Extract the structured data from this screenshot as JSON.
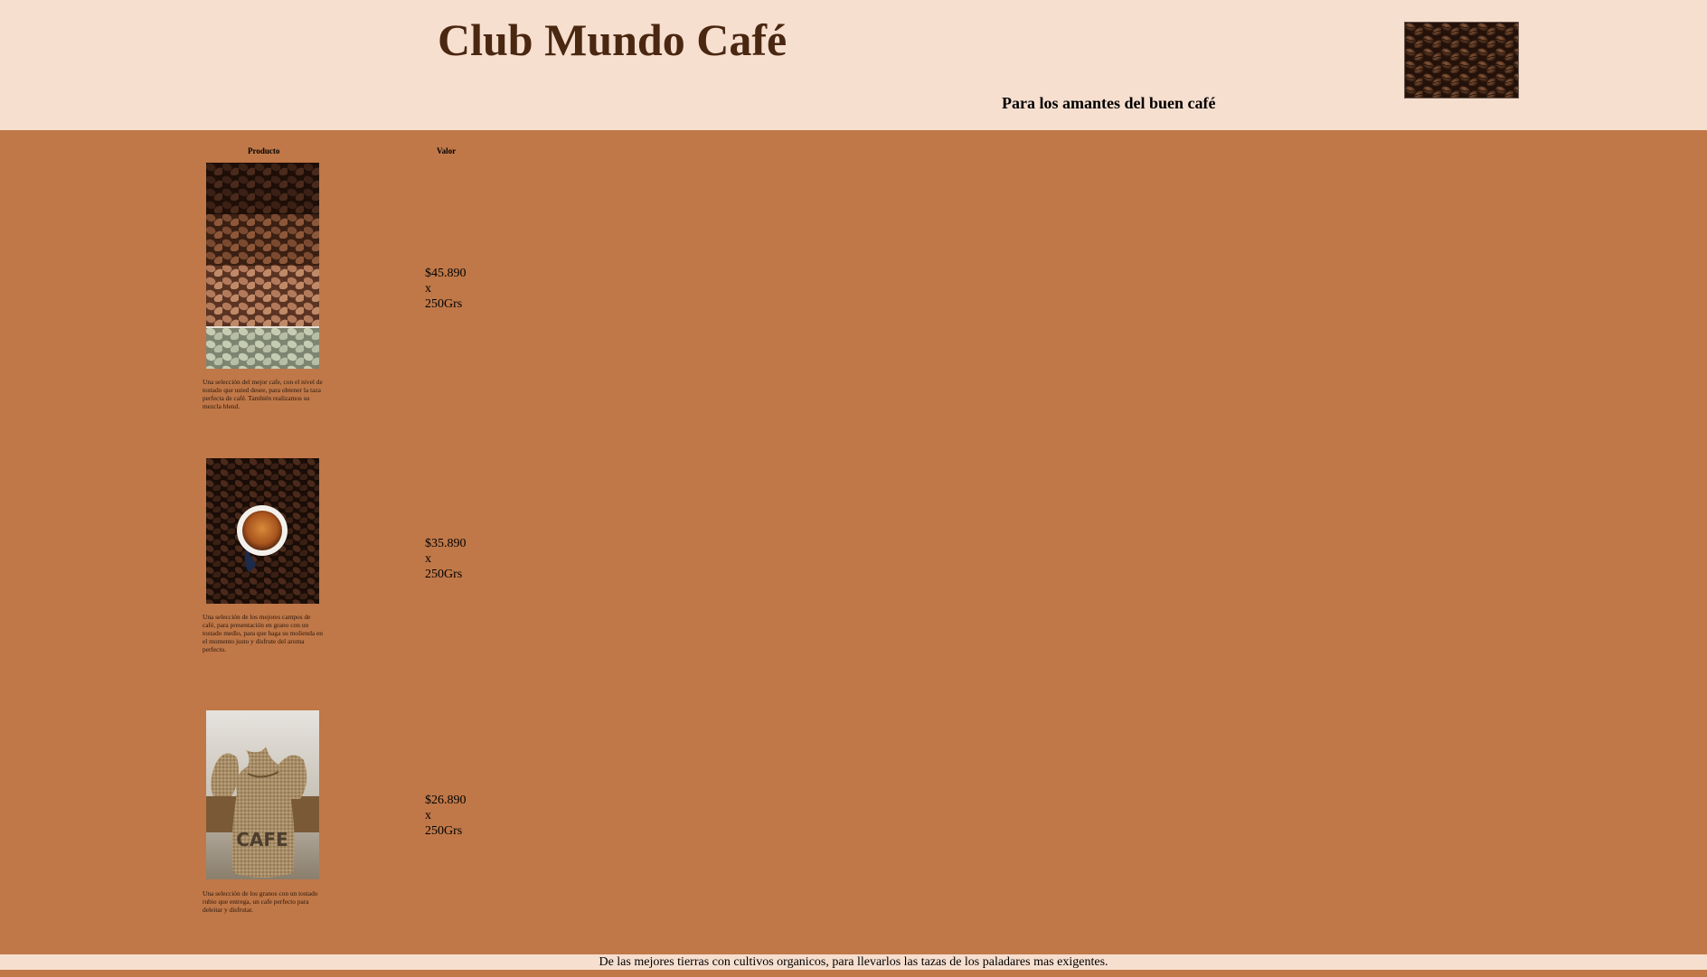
{
  "header": {
    "title": "Club Mundo Café",
    "tagline": "Para los amantes del buen café",
    "image_icon": "coffee-beans-image"
  },
  "table": {
    "headers": {
      "product": "Producto",
      "value": "Valor"
    },
    "products": [
      {
        "image_icon": "roast-levels-beans-image",
        "description": "Una selección del mejor cafe, con el nivel de tostado que usted desee, para obtener la taza perfecta de café. También realizamos su mezcla blend.",
        "price": "$45.890",
        "price_x": "x",
        "price_unit": "250Grs"
      },
      {
        "image_icon": "espresso-cup-on-beans-image",
        "description": "Una selección de los mejores campos de café, para presentación en grano con un tostado medio, para que haga su molienda en el momento justo y disfrute del aroma perfecto.",
        "price": "$35.890",
        "price_x": "x",
        "price_unit": "250Grs"
      },
      {
        "image_icon": "burlap-cafe-sack-image",
        "description": "Una selección de los granos con un tostado rubio que entrega, un cafe perfecto para deleitar y disfrutar.",
        "price": "$26.890",
        "price_x": "x",
        "price_unit": "250Grs"
      }
    ]
  },
  "footer": {
    "text": "De las mejores tierras con cultivos organicos, para llevarlos las tazas de los paladares mas exigentes."
  },
  "colors": {
    "header_bg": "#f7dfcf",
    "main_bg": "#c07848",
    "title_color": "#4a2711"
  }
}
